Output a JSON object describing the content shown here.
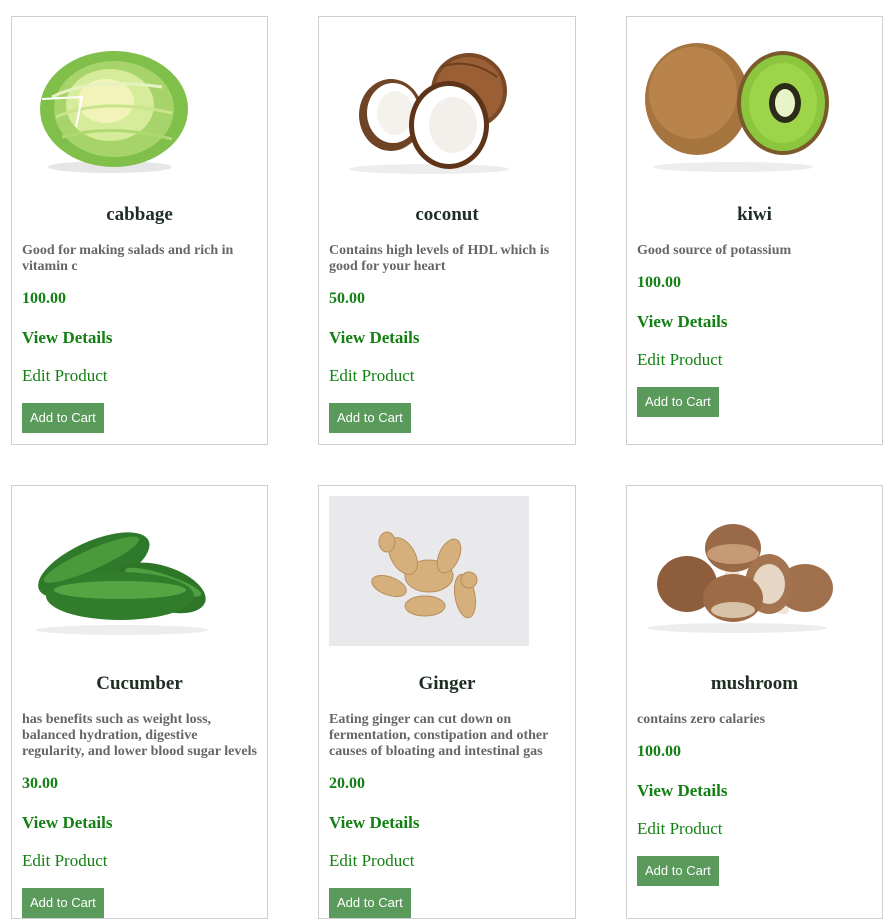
{
  "products": [
    {
      "name": "cabbage",
      "description": "Good for making salads and rich in vitamin c",
      "price": "100.00",
      "details_label": "View Details",
      "edit_label": "Edit Product",
      "cart_label": "Add to Cart",
      "image": "cabbage-image"
    },
    {
      "name": "coconut",
      "description": "Contains high levels of HDL which is good for your heart",
      "price": "50.00",
      "details_label": "View Details",
      "edit_label": "Edit Product",
      "cart_label": "Add to Cart",
      "image": "coconut-image"
    },
    {
      "name": "kiwi",
      "description": "Good source of potassium",
      "price": "100.00",
      "details_label": "View Details",
      "edit_label": "Edit Product",
      "cart_label": "Add to Cart",
      "image": "kiwi-image"
    },
    {
      "name": "Cucumber",
      "description": "has benefits such as weight loss, balanced hydration, digestive regularity, and lower blood sugar levels",
      "price": "30.00",
      "details_label": "View Details",
      "edit_label": "Edit Product",
      "cart_label": "Add to Cart",
      "image": "cucumber-image"
    },
    {
      "name": "Ginger",
      "description": "Eating ginger can cut down on fermentation, constipation and other causes of bloating and intestinal gas",
      "price": "20.00",
      "details_label": "View Details",
      "edit_label": "Edit Product",
      "cart_label": "Add to Cart",
      "image": "ginger-image"
    },
    {
      "name": "mushroom",
      "description": "contains zero calaries",
      "price": "100.00",
      "details_label": "View Details",
      "edit_label": "Edit Product",
      "cart_label": "Add to Cart",
      "image": "mushroom-image"
    }
  ],
  "colors": {
    "accent": "#138013",
    "button": "#5a9a5a",
    "border": "#cfcfcf"
  }
}
